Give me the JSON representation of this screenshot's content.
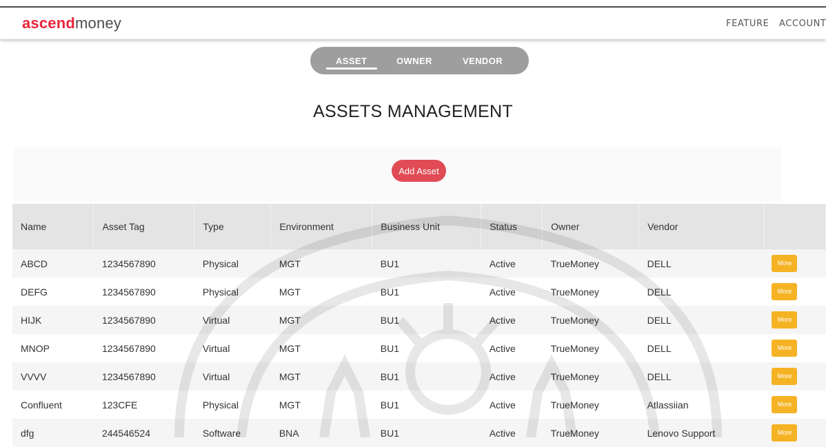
{
  "brand": {
    "part1": "ascend",
    "part2": "money"
  },
  "nav": {
    "feature": "FEATURE",
    "account": "ACCOUNT"
  },
  "tabs": [
    {
      "label": "ASSET",
      "active": true
    },
    {
      "label": "OWNER",
      "active": false
    },
    {
      "label": "VENDOR",
      "active": false
    }
  ],
  "page_title": "ASSETS MANAGEMENT",
  "add_button": "Add Asset",
  "table": {
    "columns": [
      "Name",
      "Asset Tag",
      "Type",
      "Environment",
      "Business Unit",
      "Status",
      "Owner",
      "Vendor",
      ""
    ],
    "more_label": "More",
    "rows": [
      [
        "ABCD",
        "1234567890",
        "Physical",
        "MGT",
        "BU1",
        "Active",
        "TrueMoney",
        "DELL"
      ],
      [
        "DEFG",
        "1234567890",
        "Physical",
        "MGT",
        "BU1",
        "Active",
        "TrueMoney",
        "DELL"
      ],
      [
        "HIJK",
        "1234567890",
        "Virtual",
        "MGT",
        "BU1",
        "Active",
        "TrueMoney",
        "DELL"
      ],
      [
        "MNOP",
        "1234567890",
        "Virtual",
        "MGT",
        "BU1",
        "Active",
        "TrueMoney",
        "DELL"
      ],
      [
        "VVVV",
        "1234567890",
        "Virtual",
        "MGT",
        "BU1",
        "Active",
        "TrueMoney",
        "DELL"
      ],
      [
        "Confluent",
        "123CFE",
        "Physical",
        "MGT",
        "BU1",
        "Active",
        "TrueMoney",
        "Atlassiian"
      ],
      [
        "dfg",
        "244546524",
        "Software",
        "BNA",
        "BU1",
        "Active",
        "TrueMoney",
        "Lenovo Support"
      ]
    ]
  },
  "colors": {
    "brand_red": "#e8263c",
    "add_button": "#e14b55",
    "more_button": "#f5b324",
    "tab_bar": "#9e9e9e",
    "table_header": "#e4e4e4"
  }
}
